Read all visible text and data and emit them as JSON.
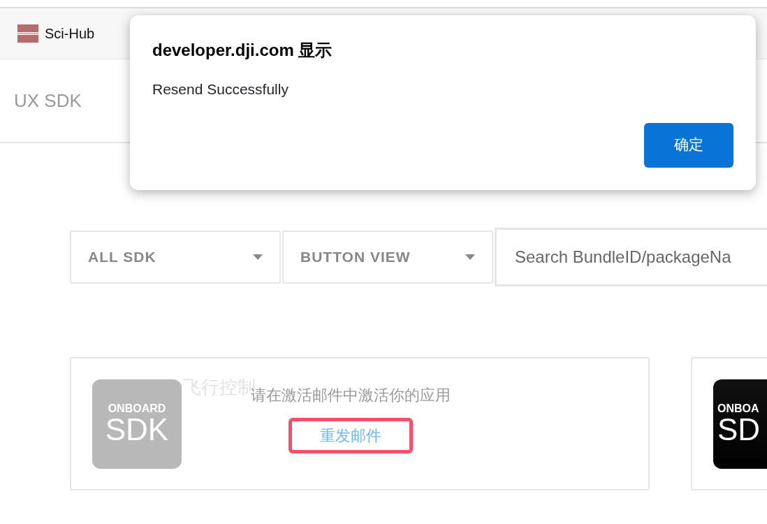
{
  "bookmarks": [
    {
      "label": "Sci-Hub"
    }
  ],
  "nav": {
    "items": [
      {
        "label": "UX SDK"
      }
    ]
  },
  "dialog": {
    "title": "developer.dji.com 显示",
    "message": "Resend Successfully",
    "button": "确定"
  },
  "filters": {
    "selects": [
      {
        "label": "ALL SDK"
      },
      {
        "label": "BUTTON VIEW"
      }
    ],
    "search": {
      "placeholder": "Search BundleID/packageNa"
    }
  },
  "apps": [
    {
      "logo_top": "ONBOARD",
      "logo_main": "SDK",
      "activated": false,
      "title": "飞行控制",
      "notice": "请在激活邮件中激活你的应用",
      "action": "重发邮件",
      "highlighted": true
    },
    {
      "logo_top": "ONBOA",
      "logo_main": "SD",
      "activated": true
    }
  ]
}
